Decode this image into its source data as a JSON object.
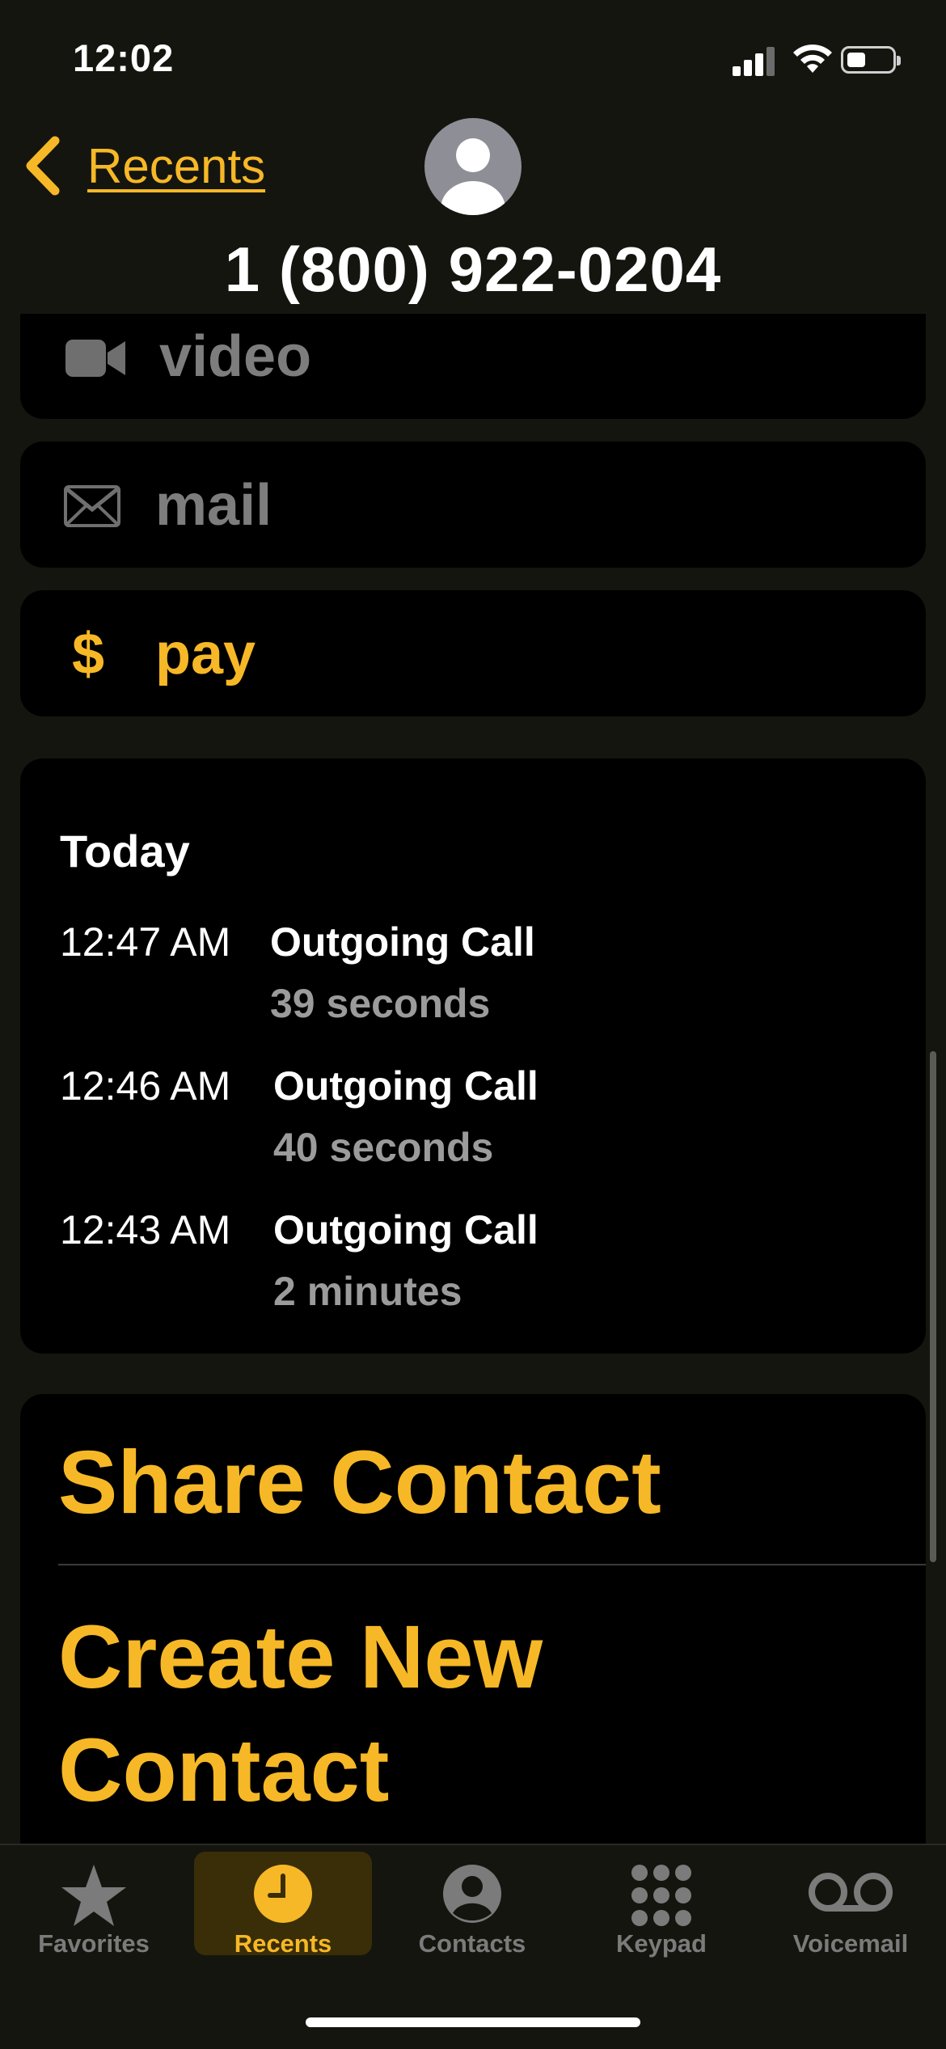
{
  "status": {
    "time": "12:02"
  },
  "header": {
    "back_label": "Recents",
    "phone_number": "1 (800) 922-0204"
  },
  "actions": [
    {
      "icon": "video-icon",
      "label": "video"
    },
    {
      "icon": "mail-icon",
      "label": "mail"
    },
    {
      "icon": "dollar-icon",
      "label": "pay",
      "symbol": "$"
    }
  ],
  "call_history": {
    "heading": "Today",
    "calls": [
      {
        "time": "12:47 AM",
        "type": "Outgoing Call",
        "duration": "39 seconds"
      },
      {
        "time": "12:46 AM",
        "type": "Outgoing Call",
        "duration": "40 seconds"
      },
      {
        "time": "12:43 AM",
        "type": "Outgoing Call",
        "duration": "2 minutes"
      }
    ]
  },
  "contact_actions": {
    "share": "Share Contact",
    "create_line1": "Create New",
    "create_line2": "Contact"
  },
  "tabs": [
    {
      "label": "Favorites",
      "icon": "star-icon"
    },
    {
      "label": "Recents",
      "icon": "clock-icon",
      "active": true
    },
    {
      "label": "Contacts",
      "icon": "person-circle-icon"
    },
    {
      "label": "Keypad",
      "icon": "keypad-icon"
    },
    {
      "label": "Voicemail",
      "icon": "voicemail-icon"
    }
  ],
  "colors": {
    "accent": "#f6b826",
    "background": "#151510",
    "card": "#000000"
  }
}
